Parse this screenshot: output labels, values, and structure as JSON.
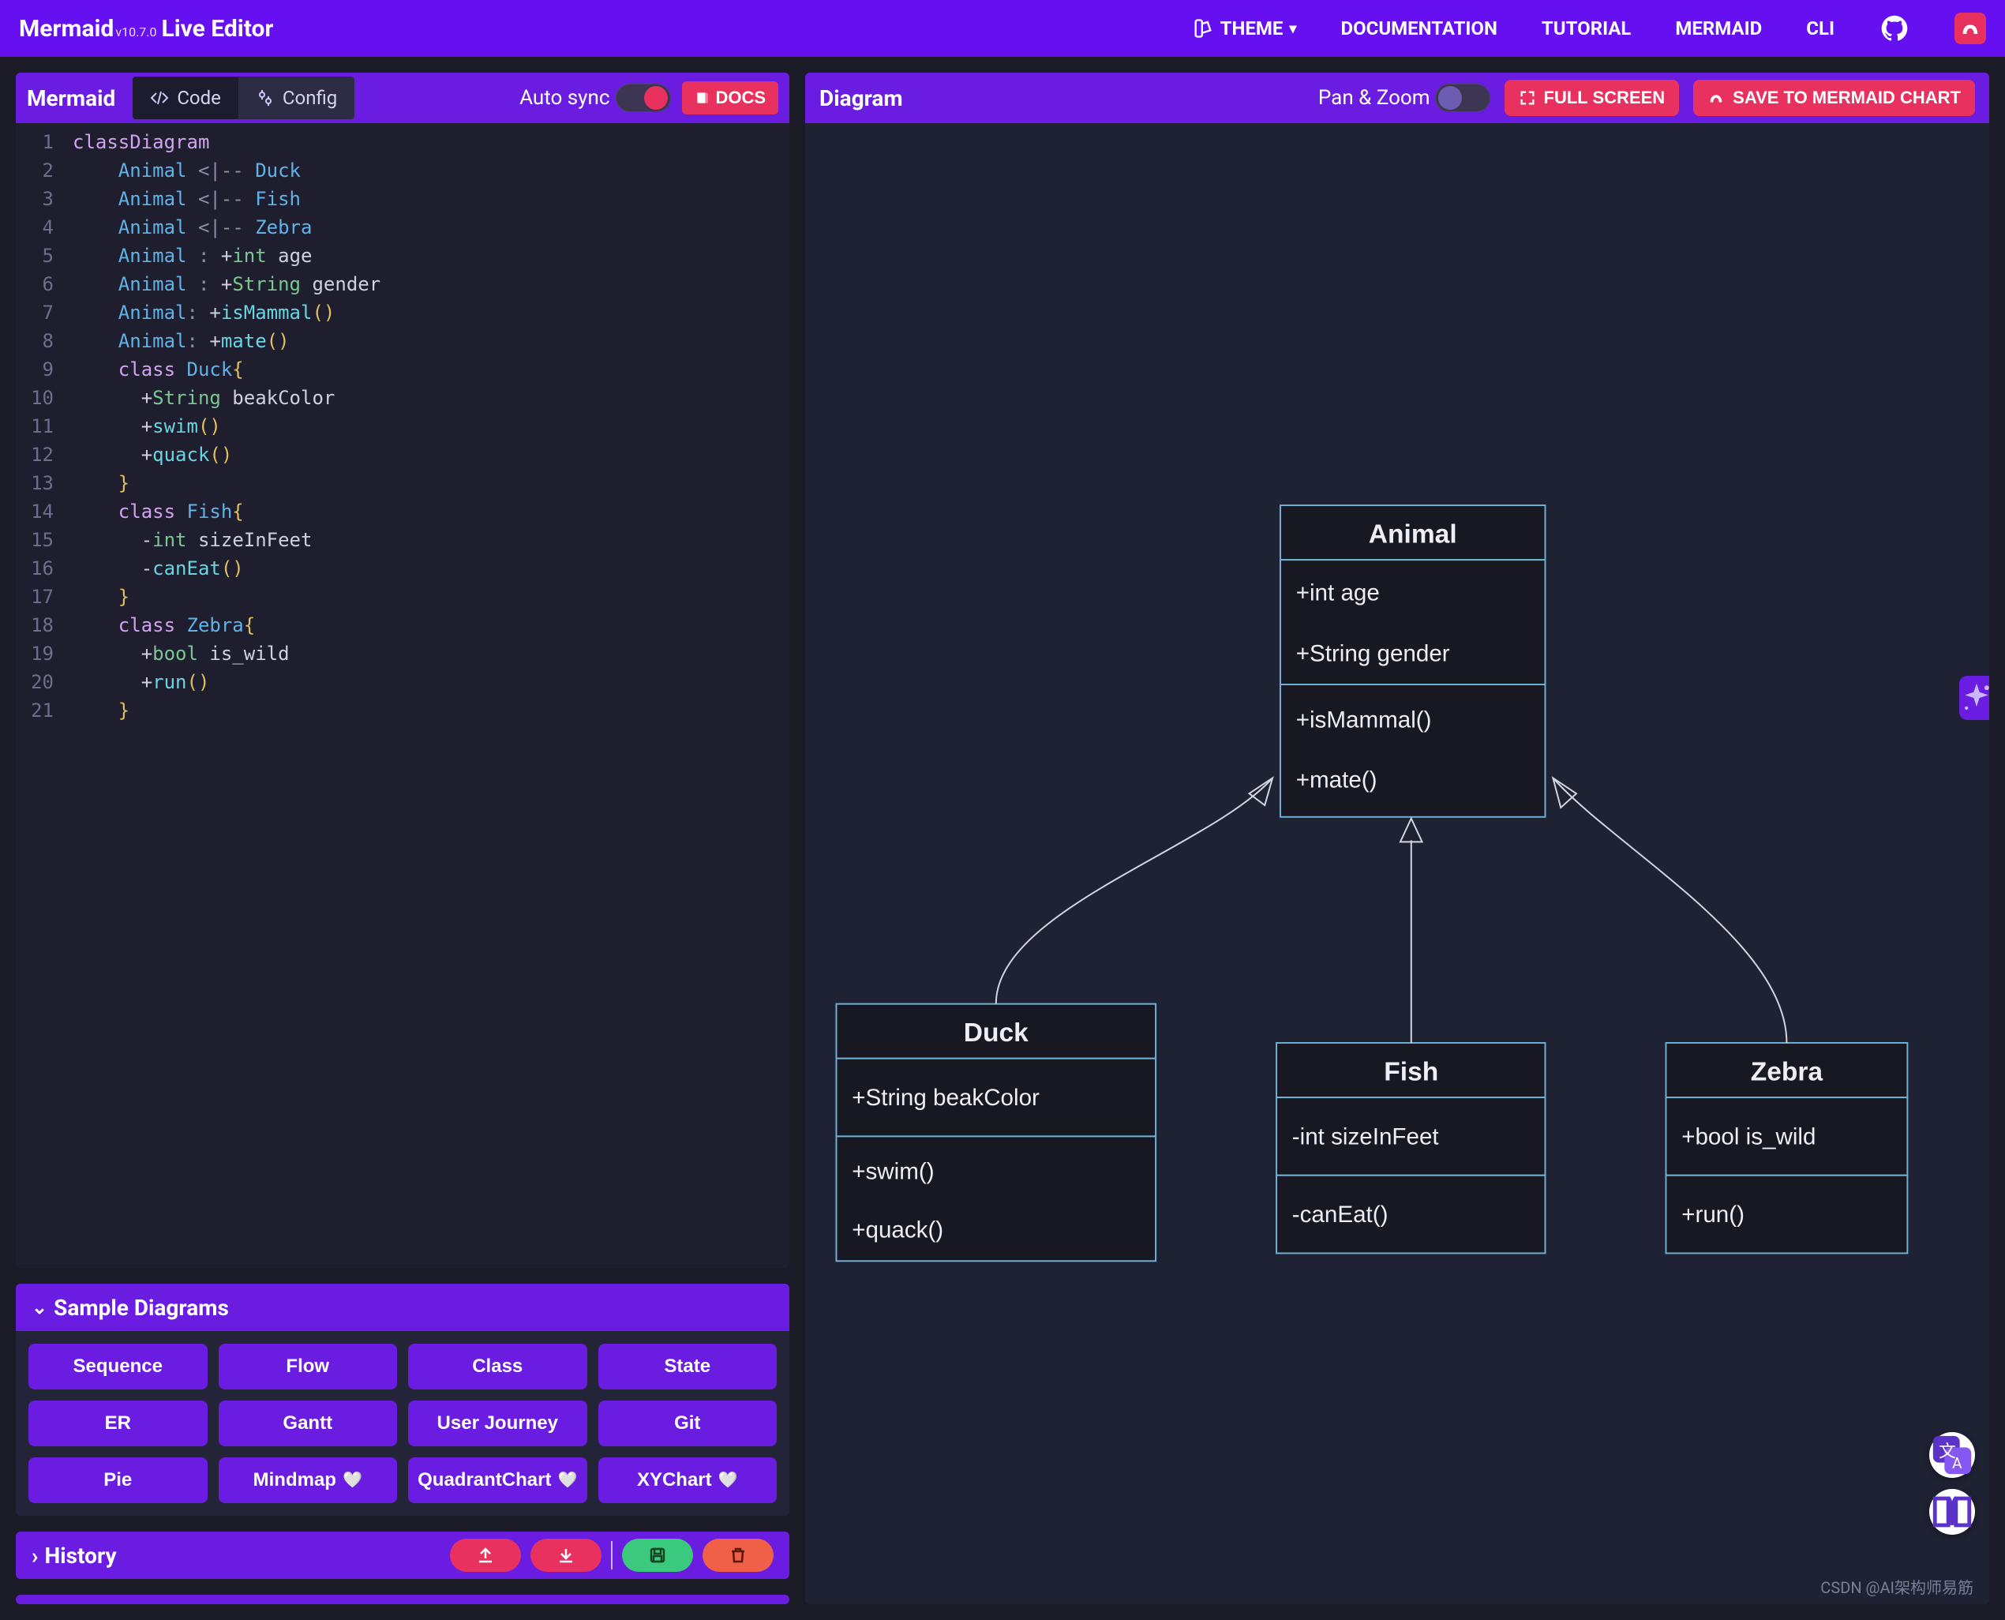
{
  "header": {
    "logo_main": "Mermaid",
    "logo_version": "v10.7.0",
    "logo_sub": "Live Editor",
    "theme_label": "THEME",
    "nav": [
      "DOCUMENTATION",
      "TUTORIAL",
      "MERMAID",
      "CLI"
    ]
  },
  "editor_panel": {
    "title": "Mermaid",
    "tab_code": "Code",
    "tab_config": "Config",
    "autosync_label": "Auto sync",
    "docs_label": "DOCS"
  },
  "code_lines": [
    {
      "n": "1",
      "tokens": [
        [
          "kw",
          "classDiagram"
        ]
      ]
    },
    {
      "n": "2",
      "tokens": [
        [
          "pad",
          "    "
        ],
        [
          "cls",
          "Animal"
        ],
        [
          "txt",
          " "
        ],
        [
          "op",
          "<|--"
        ],
        [
          "txt",
          " "
        ],
        [
          "cls",
          "Duck"
        ]
      ]
    },
    {
      "n": "3",
      "tokens": [
        [
          "pad",
          "    "
        ],
        [
          "cls",
          "Animal"
        ],
        [
          "txt",
          " "
        ],
        [
          "op",
          "<|--"
        ],
        [
          "txt",
          " "
        ],
        [
          "cls",
          "Fish"
        ]
      ]
    },
    {
      "n": "4",
      "tokens": [
        [
          "pad",
          "    "
        ],
        [
          "cls",
          "Animal"
        ],
        [
          "txt",
          " "
        ],
        [
          "op",
          "<|--"
        ],
        [
          "txt",
          " "
        ],
        [
          "cls",
          "Zebra"
        ]
      ]
    },
    {
      "n": "5",
      "tokens": [
        [
          "pad",
          "    "
        ],
        [
          "cls",
          "Animal"
        ],
        [
          "txt",
          " "
        ],
        [
          "op",
          ":"
        ],
        [
          "txt",
          " "
        ],
        [
          "pl",
          "+"
        ],
        [
          "str",
          "int"
        ],
        [
          "txt",
          " age"
        ]
      ]
    },
    {
      "n": "6",
      "tokens": [
        [
          "pad",
          "    "
        ],
        [
          "cls",
          "Animal"
        ],
        [
          "txt",
          " "
        ],
        [
          "op",
          ":"
        ],
        [
          "txt",
          " "
        ],
        [
          "pl",
          "+"
        ],
        [
          "str",
          "String"
        ],
        [
          "txt",
          " gender"
        ]
      ]
    },
    {
      "n": "7",
      "tokens": [
        [
          "pad",
          "    "
        ],
        [
          "cls",
          "Animal"
        ],
        [
          "op",
          ":"
        ],
        [
          "txt",
          " "
        ],
        [
          "pl",
          "+"
        ],
        [
          "fn",
          "isMammal"
        ],
        [
          "par",
          "()"
        ]
      ]
    },
    {
      "n": "8",
      "tokens": [
        [
          "pad",
          "    "
        ],
        [
          "cls",
          "Animal"
        ],
        [
          "op",
          ":"
        ],
        [
          "txt",
          " "
        ],
        [
          "pl",
          "+"
        ],
        [
          "fn",
          "mate"
        ],
        [
          "par",
          "()"
        ]
      ]
    },
    {
      "n": "9",
      "tokens": [
        [
          "pad",
          "    "
        ],
        [
          "kw",
          "class"
        ],
        [
          "txt",
          " "
        ],
        [
          "cls",
          "Duck"
        ],
        [
          "par",
          "{"
        ]
      ]
    },
    {
      "n": "10",
      "tokens": [
        [
          "pad",
          "      "
        ],
        [
          "pl",
          "+"
        ],
        [
          "str",
          "String"
        ],
        [
          "txt",
          " beakColor"
        ]
      ]
    },
    {
      "n": "11",
      "tokens": [
        [
          "pad",
          "      "
        ],
        [
          "pl",
          "+"
        ],
        [
          "fn",
          "swim"
        ],
        [
          "par",
          "()"
        ]
      ]
    },
    {
      "n": "12",
      "tokens": [
        [
          "pad",
          "      "
        ],
        [
          "pl",
          "+"
        ],
        [
          "fn",
          "quack"
        ],
        [
          "par",
          "()"
        ]
      ]
    },
    {
      "n": "13",
      "tokens": [
        [
          "pad",
          "    "
        ],
        [
          "par",
          "}"
        ]
      ]
    },
    {
      "n": "14",
      "tokens": [
        [
          "pad",
          "    "
        ],
        [
          "kw",
          "class"
        ],
        [
          "txt",
          " "
        ],
        [
          "cls",
          "Fish"
        ],
        [
          "par",
          "{"
        ]
      ]
    },
    {
      "n": "15",
      "tokens": [
        [
          "pad",
          "      "
        ],
        [
          "pl",
          "-"
        ],
        [
          "str",
          "int"
        ],
        [
          "txt",
          " sizeInFeet"
        ]
      ]
    },
    {
      "n": "16",
      "tokens": [
        [
          "pad",
          "      "
        ],
        [
          "pl",
          "-"
        ],
        [
          "fn",
          "canEat"
        ],
        [
          "par",
          "()"
        ]
      ]
    },
    {
      "n": "17",
      "tokens": [
        [
          "pad",
          "    "
        ],
        [
          "par",
          "}"
        ]
      ]
    },
    {
      "n": "18",
      "tokens": [
        [
          "pad",
          "    "
        ],
        [
          "kw",
          "class"
        ],
        [
          "txt",
          " "
        ],
        [
          "cls",
          "Zebra"
        ],
        [
          "par",
          "{"
        ]
      ]
    },
    {
      "n": "19",
      "tokens": [
        [
          "pad",
          "      "
        ],
        [
          "pl",
          "+"
        ],
        [
          "str",
          "bool"
        ],
        [
          "txt",
          " is_wild"
        ]
      ]
    },
    {
      "n": "20",
      "tokens": [
        [
          "pad",
          "      "
        ],
        [
          "pl",
          "+"
        ],
        [
          "fn",
          "run"
        ],
        [
          "par",
          "()"
        ]
      ]
    },
    {
      "n": "21",
      "tokens": [
        [
          "pad",
          "    "
        ],
        [
          "par",
          "}"
        ]
      ]
    }
  ],
  "sample": {
    "title": "Sample Diagrams",
    "items": [
      "Sequence",
      "Flow",
      "Class",
      "State",
      "ER",
      "Gantt",
      "User Journey",
      "Git",
      "Pie",
      "Mindmap",
      "QuadrantChart",
      "XYChart"
    ],
    "hearts": {
      "9": true,
      "10": true,
      "11": true
    }
  },
  "history": {
    "title": "History"
  },
  "diagram": {
    "title": "Diagram",
    "pan_zoom": "Pan & Zoom",
    "fullscreen": "FULL SCREEN",
    "save": "SAVE TO MERMAID CHART",
    "classes": {
      "Animal": {
        "attrs": [
          "+int age",
          "+String gender"
        ],
        "methods": [
          "+isMammal()",
          "+mate()"
        ]
      },
      "Duck": {
        "attrs": [
          "+String beakColor"
        ],
        "methods": [
          "+swim()",
          "+quack()"
        ]
      },
      "Fish": {
        "attrs": [
          "-int sizeInFeet"
        ],
        "methods": [
          "-canEat()"
        ]
      },
      "Zebra": {
        "attrs": [
          "+bool is_wild"
        ],
        "methods": [
          "+run()"
        ]
      }
    }
  },
  "watermark": "CSDN @AI架构师易筋"
}
